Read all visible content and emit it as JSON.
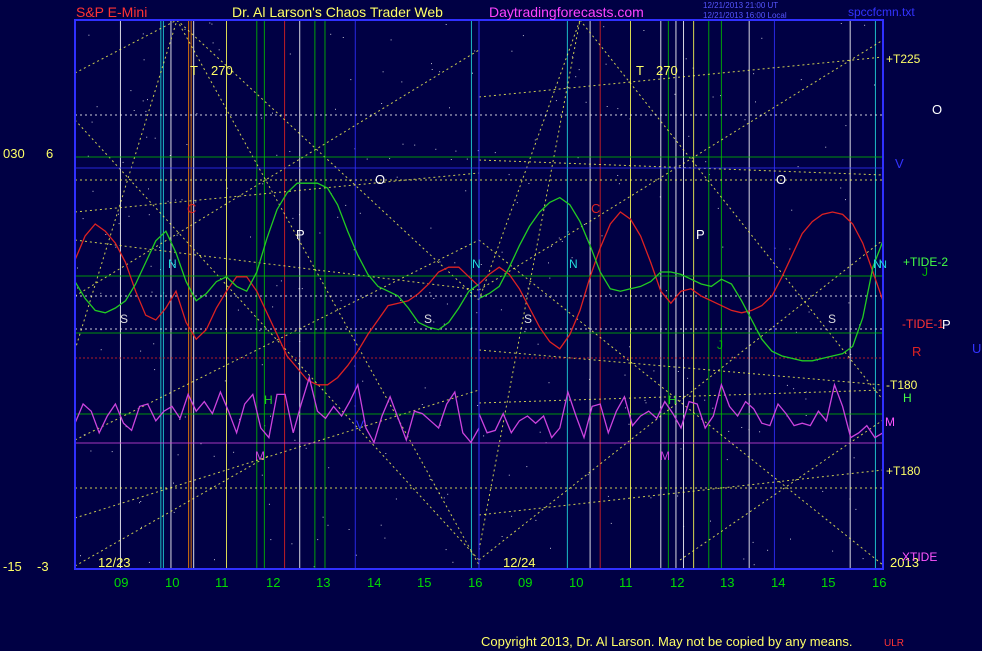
{
  "header": {
    "left_title": "S&P E-Mini",
    "center_title": "Dr. Al Larson's Chaos Trader Web",
    "site": "Daytradingforecasts.com",
    "stamp1": "12/21/2013 21:00 UT",
    "stamp2": "12/21/2013 16:00 Local",
    "file": "spccfcmn.txt"
  },
  "left_axis": {
    "upper_a": "030",
    "upper_b": "6",
    "lower_a": "-15",
    "lower_b": "-3"
  },
  "footer": {
    "copyright": "Copyright 2013, Dr. Al Larson. May not be copied by any means.",
    "tag": "ULR"
  },
  "colors": {
    "background": "#000044",
    "frame": "#3030ff",
    "price": "#dd2222",
    "tide": "#22cc22",
    "xtide": "#cc44dd",
    "yellow": "#ffff55",
    "white": "#ffffff",
    "cyan": "#22dddd",
    "orange": "#ff8800",
    "green": "#00bb00"
  },
  "chart_data": {
    "type": "line",
    "days": [
      "12/23",
      "12/24"
    ],
    "year": "2013",
    "x_tick_labels": [
      "09",
      "10",
      "11",
      "12",
      "13",
      "14",
      "15",
      "16",
      "09",
      "10",
      "11",
      "12",
      "13",
      "14",
      "15",
      "16"
    ],
    "series": [
      {
        "name": "TIDE-1",
        "label": "-TIDE-1",
        "color": "#dd2222",
        "x": [
          8.0,
          8.2,
          8.4,
          8.6,
          8.8,
          9.0,
          9.2,
          9.4,
          9.6,
          9.8,
          10.0,
          10.2,
          10.4,
          10.6,
          10.8,
          11.0,
          11.2,
          11.4,
          11.6,
          11.8,
          12.0,
          12.2,
          12.4,
          12.6,
          12.8,
          13.0,
          13.2,
          13.4,
          13.6,
          13.8,
          14.0,
          14.2,
          14.4,
          14.6,
          14.8,
          15.0,
          15.2,
          15.4,
          15.6,
          15.8,
          16.0
        ],
        "y": [
          15,
          25,
          30,
          27,
          22,
          14,
          2,
          -8,
          -10,
          -5,
          2,
          -11,
          -18,
          -14,
          -5,
          2,
          8,
          8,
          2,
          -7,
          -16,
          -25,
          -30,
          -35,
          -37,
          -37,
          -34,
          -29,
          -23,
          -16,
          -10,
          -4,
          -3,
          -2,
          1,
          5,
          10,
          12,
          12,
          8,
          4
        ]
      },
      {
        "name": "TIDE-1",
        "label": "",
        "color": "#dd2222",
        "x": [
          8.0,
          8.2,
          8.4,
          8.6,
          8.8,
          9.0,
          9.2,
          9.4,
          9.6,
          9.8,
          10.0,
          10.2,
          10.4,
          10.6,
          10.8,
          11.0,
          11.2,
          11.4,
          11.6,
          11.8,
          12.0,
          12.2,
          12.4,
          12.6,
          12.8,
          13.0,
          13.2,
          13.4,
          13.6,
          13.8,
          14.0,
          14.2,
          14.4,
          14.6,
          14.8,
          15.0,
          15.2,
          15.4,
          15.6,
          15.8,
          16.0
        ],
        "y": [
          5,
          9,
          12,
          9,
          3,
          -5,
          -13,
          -19,
          -22,
          -16,
          -6,
          8,
          20,
          30,
          35,
          32,
          25,
          14,
          2,
          -3,
          2,
          3,
          0,
          -2,
          -4,
          -6,
          -7,
          -6,
          -4,
          0,
          8,
          17,
          26,
          31,
          34,
          35,
          34,
          30,
          22,
          10,
          -2
        ]
      },
      {
        "name": "TIDE-2",
        "label": "+TIDE-2",
        "color": "#22cc22",
        "x": [
          8.0,
          8.2,
          8.4,
          8.6,
          8.8,
          9.0,
          9.2,
          9.4,
          9.6,
          9.8,
          10.0,
          10.2,
          10.4,
          10.6,
          10.8,
          11.0,
          11.2,
          11.4,
          11.6,
          11.8,
          12.0,
          12.2,
          12.4,
          12.6,
          12.8,
          13.0,
          13.2,
          13.4,
          13.6,
          13.8,
          14.0,
          14.2,
          14.4,
          14.6,
          14.8,
          15.0,
          15.2,
          15.4,
          15.6,
          15.8,
          16.0
        ],
        "y": [
          6,
          -1,
          -6,
          -7,
          -5,
          -2,
          5,
          14,
          23,
          27,
          18,
          6,
          -2,
          1,
          6,
          8,
          4,
          2,
          10,
          24,
          36,
          43,
          47,
          47,
          47,
          45,
          38,
          27,
          17,
          9,
          4,
          2,
          0,
          -5,
          -11,
          -13,
          -14,
          -11,
          -5,
          2,
          5
        ]
      },
      {
        "name": "TIDE-2",
        "label": "",
        "color": "#22cc22",
        "x": [
          8.0,
          8.2,
          8.4,
          8.6,
          8.8,
          9.0,
          9.2,
          9.4,
          9.6,
          9.8,
          10.0,
          10.2,
          10.4,
          10.6,
          10.8,
          11.0,
          11.2,
          11.4,
          11.6,
          11.8,
          12.0,
          12.2,
          12.4,
          12.6,
          12.8,
          13.0,
          13.2,
          13.4,
          13.6,
          13.8,
          14.0,
          14.2,
          14.4,
          14.6,
          14.8,
          15.0,
          15.2,
          15.4,
          15.6,
          15.8,
          16.0
        ],
        "y": [
          -1,
          1,
          4,
          12,
          21,
          29,
          35,
          39,
          41,
          38,
          31,
          21,
          10,
          3,
          2,
          3,
          4,
          6,
          10,
          10,
          9,
          7,
          5,
          4,
          7,
          5,
          -2,
          -10,
          -18,
          -23,
          -25,
          -26,
          -27,
          -27,
          -26,
          -25,
          -24,
          -21,
          -9,
          12,
          23
        ]
      },
      {
        "name": "XTIDE",
        "label": "XTIDE",
        "color": "#cc44dd",
        "x": [
          8.0,
          8.16,
          8.32,
          8.48,
          8.64,
          8.8,
          8.96,
          9.12,
          9.28,
          9.44,
          9.6,
          9.76,
          9.92,
          10.08,
          10.24,
          10.4,
          10.56,
          10.72,
          10.88,
          11.04,
          11.2,
          11.36,
          11.52,
          11.68,
          11.84,
          12.0,
          12.16,
          12.32,
          12.48,
          12.64,
          12.8,
          12.96,
          13.12,
          13.28,
          13.44,
          13.6,
          13.76,
          13.92,
          14.08,
          14.24,
          14.4,
          14.56,
          14.72,
          14.88,
          15.04,
          15.2,
          15.36,
          15.52,
          15.68,
          15.84,
          16.0
        ],
        "y": [
          -53,
          -45,
          -48,
          -57,
          -50,
          -45,
          -53,
          -56,
          -46,
          -45,
          -52,
          -48,
          -46,
          -51,
          -41,
          -48,
          -44,
          -49,
          -40,
          -48,
          -57,
          -45,
          -41,
          -55,
          -59,
          -41,
          -41,
          -57,
          -45,
          -34,
          -48,
          -51,
          -46,
          -50,
          -44,
          -37,
          -55,
          -61,
          -50,
          -42,
          -51,
          -60,
          -48,
          -49,
          -52,
          -55,
          -45,
          -40,
          -57,
          -61,
          -55
        ]
      },
      {
        "name": "XTIDE",
        "label": "",
        "color": "#cc44dd",
        "x": [
          8.0,
          8.16,
          8.32,
          8.48,
          8.64,
          8.8,
          8.96,
          9.12,
          9.28,
          9.44,
          9.6,
          9.76,
          9.92,
          10.08,
          10.24,
          10.4,
          10.56,
          10.72,
          10.88,
          11.04,
          11.2,
          11.36,
          11.52,
          11.68,
          11.84,
          12.0,
          12.16,
          12.32,
          12.48,
          12.64,
          12.8,
          12.96,
          13.12,
          13.28,
          13.44,
          13.6,
          13.76,
          13.92,
          14.08,
          14.24,
          14.4,
          14.56,
          14.72,
          14.88,
          15.04,
          15.2,
          15.36,
          15.52,
          15.68,
          15.84,
          16.0
        ],
        "y": [
          -49,
          -57,
          -56,
          -49,
          -57,
          -52,
          -50,
          -53,
          -50,
          -59,
          -55,
          -40,
          -50,
          -59,
          -46,
          -45,
          -57,
          -48,
          -42,
          -54,
          -50,
          -48,
          -51,
          -44,
          -49,
          -55,
          -44,
          -45,
          -55,
          -50,
          -37,
          -46,
          -50,
          -44,
          -47,
          -53,
          -54,
          -45,
          -49,
          -54,
          -53,
          -54,
          -48,
          -52,
          -37,
          -46,
          -59,
          -57,
          -54,
          -59,
          -57
        ]
      }
    ],
    "level_labels": [
      "+T225",
      "V",
      "+TIDE-2",
      "J",
      "-TIDE-1",
      "P",
      "R",
      "U",
      "-T180",
      "H",
      "M",
      "+T180",
      "XTIDE",
      "2013",
      "O"
    ],
    "markers": [
      "T",
      "270",
      "T",
      "270",
      "N",
      "N",
      "N",
      "N",
      "N",
      "S",
      "S",
      "S",
      "S",
      "P",
      "P",
      "O",
      "O",
      "C",
      "C",
      "H",
      "H",
      "M",
      "M",
      "V",
      "J"
    ]
  }
}
